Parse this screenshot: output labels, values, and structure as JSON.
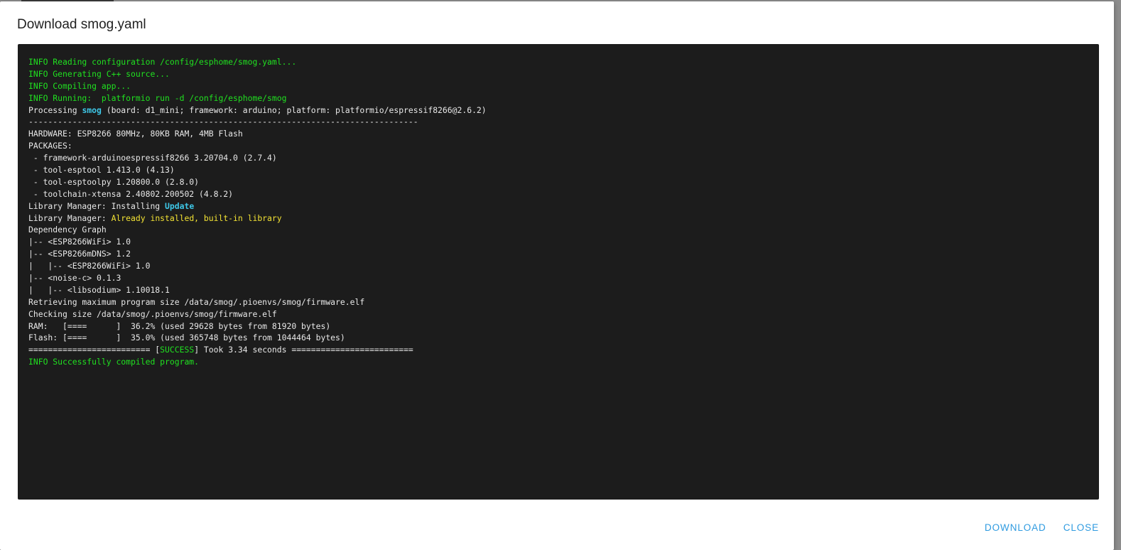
{
  "dialog": {
    "title": "Download smog.yaml",
    "actions": [
      {
        "label": "DOWNLOAD"
      },
      {
        "label": "CLOSE"
      }
    ]
  },
  "colors": {
    "terminal_bg": "#1c1c1c",
    "info_green": "#20e020",
    "highlight_cyan": "#3ec8e8",
    "warning_yellow": "#f2e234",
    "button_blue": "#2f9be0"
  },
  "log": [
    [
      {
        "text": "INFO Reading configuration /config/esphome/smog.yaml...",
        "color": "green"
      }
    ],
    [
      {
        "text": "INFO Generating C++ source...",
        "color": "green"
      }
    ],
    [
      {
        "text": "INFO Compiling app...",
        "color": "green"
      }
    ],
    [
      {
        "text": "INFO Running:  platformio run -d /config/esphome/smog",
        "color": "green"
      }
    ],
    [
      {
        "text": "Processing ",
        "color": "white"
      },
      {
        "text": "smog",
        "color": "cyan"
      },
      {
        "text": " (board: d1_mini; framework: arduino; platform: platformio/espressif8266@2.6.2)",
        "color": "white"
      }
    ],
    [
      {
        "text": "--------------------------------------------------------------------------------",
        "color": "white"
      }
    ],
    [
      {
        "text": "HARDWARE: ESP8266 80MHz, 80KB RAM, 4MB Flash",
        "color": "white"
      }
    ],
    [
      {
        "text": "PACKAGES:",
        "color": "white"
      }
    ],
    [
      {
        "text": " - framework-arduinoespressif8266 3.20704.0 (2.7.4)",
        "color": "white"
      }
    ],
    [
      {
        "text": " - tool-esptool 1.413.0 (4.13)",
        "color": "white"
      }
    ],
    [
      {
        "text": " - tool-esptoolpy 1.20800.0 (2.8.0)",
        "color": "white"
      }
    ],
    [
      {
        "text": " - toolchain-xtensa 2.40802.200502 (4.8.2)",
        "color": "white"
      }
    ],
    [
      {
        "text": "Library Manager: Installing ",
        "color": "white"
      },
      {
        "text": "Update",
        "color": "cyan"
      }
    ],
    [
      {
        "text": "Library Manager: ",
        "color": "white"
      },
      {
        "text": "Already installed, built-in library",
        "color": "yellow"
      }
    ],
    [
      {
        "text": "Dependency Graph",
        "color": "white"
      }
    ],
    [
      {
        "text": "|-- <ESP8266WiFi> 1.0",
        "color": "white"
      }
    ],
    [
      {
        "text": "|-- <ESP8266mDNS> 1.2",
        "color": "white"
      }
    ],
    [
      {
        "text": "|   |-- <ESP8266WiFi> 1.0",
        "color": "white"
      }
    ],
    [
      {
        "text": "|-- <noise-c> 0.1.3",
        "color": "white"
      }
    ],
    [
      {
        "text": "|   |-- <libsodium> 1.10018.1",
        "color": "white"
      }
    ],
    [
      {
        "text": "Retrieving maximum program size /data/smog/.pioenvs/smog/firmware.elf",
        "color": "white"
      }
    ],
    [
      {
        "text": "Checking size /data/smog/.pioenvs/smog/firmware.elf",
        "color": "white"
      }
    ],
    [
      {
        "text": "RAM:   [====      ]  36.2% (used 29628 bytes from 81920 bytes)",
        "color": "white"
      }
    ],
    [
      {
        "text": "Flash: [====      ]  35.0% (used 365748 bytes from 1044464 bytes)",
        "color": "white"
      }
    ],
    [
      {
        "text": "========================= [",
        "color": "white"
      },
      {
        "text": "SUCCESS",
        "color": "green"
      },
      {
        "text": "] Took 3.34 seconds =========================",
        "color": "white"
      }
    ],
    [
      {
        "text": "INFO Successfully compiled program.",
        "color": "green"
      }
    ]
  ]
}
